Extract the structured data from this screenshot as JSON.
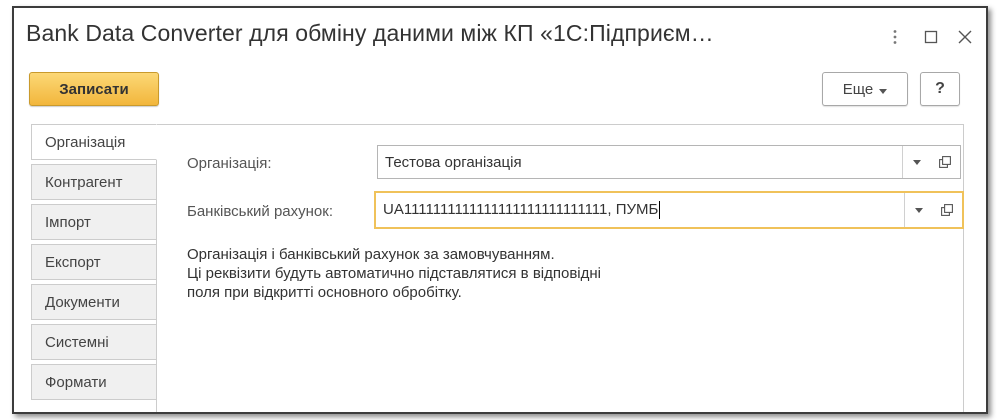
{
  "window": {
    "title": "Bank Data Converter для обміну даними між КП «1С:Підприєм…",
    "icons": {
      "menu": "more-vertical-icon",
      "maximize": "maximize-icon",
      "close": "close-icon"
    }
  },
  "toolbar": {
    "save_label": "Записати",
    "more_label": "Еще",
    "help_label": "?"
  },
  "tabs": [
    {
      "label": "Організація",
      "active": true
    },
    {
      "label": "Контрагент",
      "active": false
    },
    {
      "label": "Імпорт",
      "active": false
    },
    {
      "label": "Експорт",
      "active": false
    },
    {
      "label": "Документи",
      "active": false
    },
    {
      "label": "Системні",
      "active": false
    },
    {
      "label": "Формати",
      "active": false
    }
  ],
  "form": {
    "organization": {
      "label": "Організація:",
      "value": "Тестова організація"
    },
    "bank_account": {
      "label": "Банківський рахунок:",
      "value": "UA1111111111111111111111111111, ПУМБ"
    },
    "hint_lines": [
      "Організація і банківський рахунок за замовчуванням.",
      "Ці реквізити будуть автоматично підставлятися в відповідні",
      "поля при відкритті основного обробітку."
    ]
  },
  "colors": {
    "accent_button": "#f2b63c",
    "focus_border": "#f0c25a",
    "text": "#333333"
  }
}
